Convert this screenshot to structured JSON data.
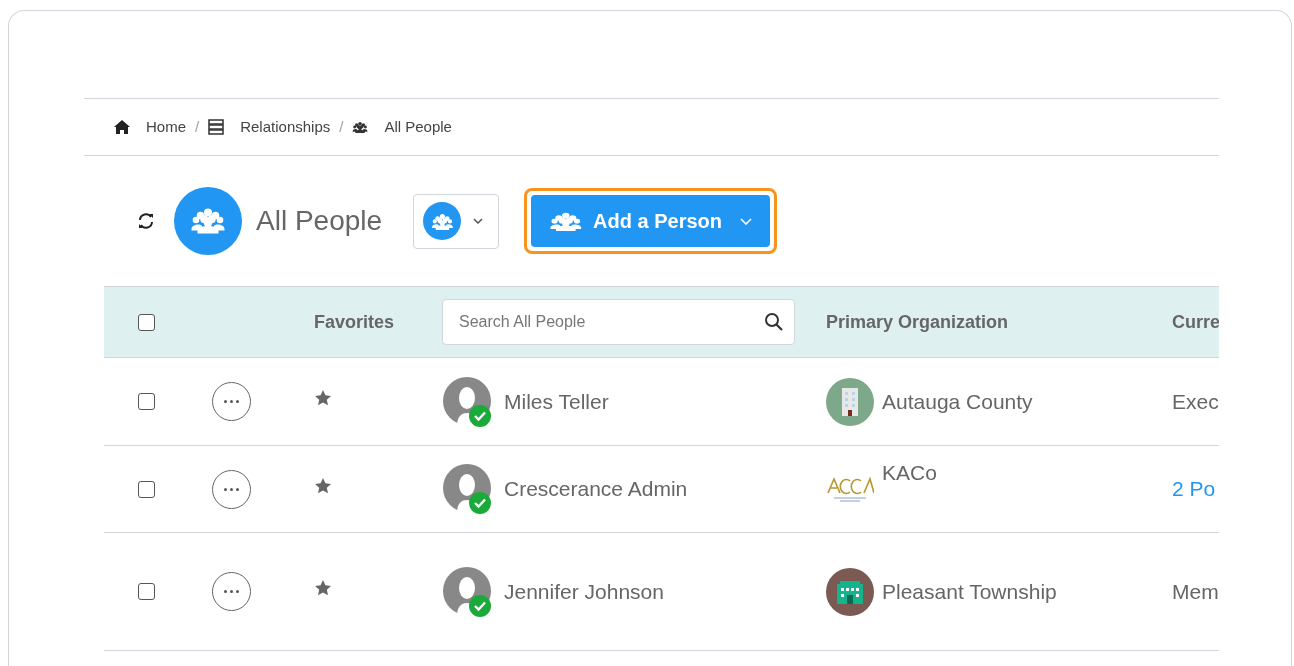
{
  "breadcrumb": [
    {
      "kind": "home",
      "label": "Home"
    },
    {
      "kind": "server",
      "separator": "/",
      "label": "Relationships"
    },
    {
      "kind": "people",
      "separator": "/",
      "label": "All People"
    }
  ],
  "header": {
    "title": "All People",
    "add_button": "Add a Person"
  },
  "table": {
    "columns": {
      "select_all": {
        "checked": false
      },
      "favorites": "Favorites",
      "search": {
        "placeholder": "Search All People"
      },
      "organization": "Primary Organization",
      "current": "Curre"
    },
    "rows": [
      {
        "checked": false,
        "name": "Miles Teller",
        "verified": true,
        "organization": "Autauga County",
        "logo": {
          "kind": "tower"
        },
        "current": {
          "kind": "text",
          "text": "Exec"
        }
      },
      {
        "checked": false,
        "name": "Crescerance Admin",
        "verified": true,
        "organization": "KACo",
        "logo": {
          "kind": "wordmark"
        },
        "current": {
          "kind": "link",
          "text": "2 Po"
        }
      },
      {
        "checked": false,
        "name": "Jennifer Johnson",
        "verified": true,
        "organization": "Pleasant Township",
        "logo": {
          "kind": "office"
        },
        "current": {
          "kind": "text",
          "text": "Mem"
        }
      }
    ]
  }
}
